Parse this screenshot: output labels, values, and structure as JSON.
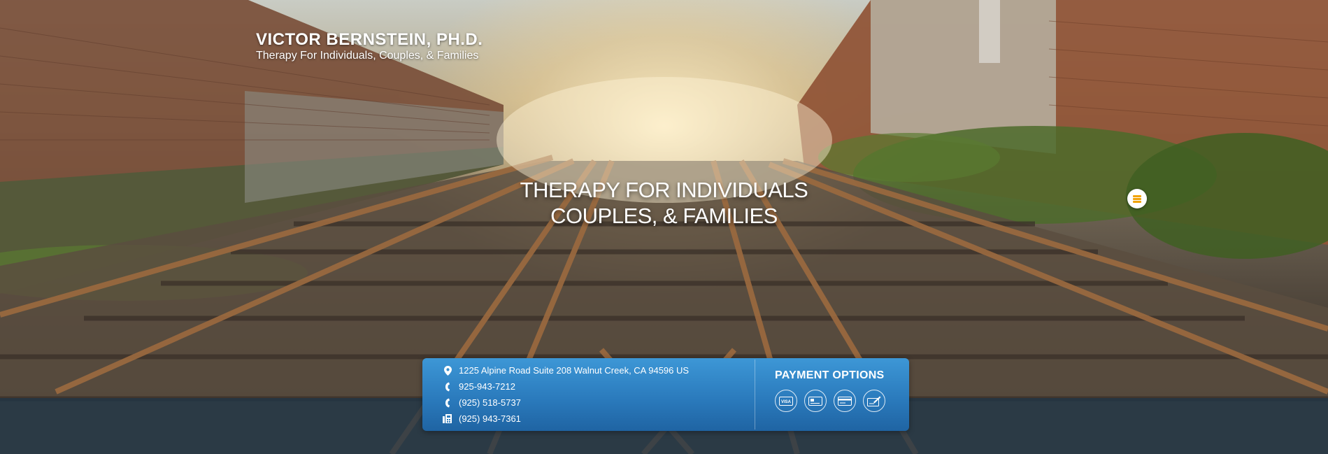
{
  "site": {
    "name": "VICTOR BERNSTEIN, PH.D.",
    "tagline": "Therapy For Individuals, Couples, & Families"
  },
  "hero": {
    "headline_line1": "THERAPY FOR INDIVIDUALS",
    "headline_line2": "COUPLES, & FAMILIES"
  },
  "menu": {
    "icon": "hamburger-menu-icon",
    "accent": "#f0a30a"
  },
  "contact": {
    "address": "1225 Alpine Road Suite 208 Walnut Creek, CA 94596 US",
    "phone1": "925-943-7212",
    "phone2": "(925) 518-5737",
    "fax": "(925) 943-7361",
    "icons": [
      "map-pin-icon",
      "phone-icon",
      "phone-icon",
      "fax-icon"
    ]
  },
  "payment": {
    "title": "PAYMENT OPTIONS",
    "methods": [
      "VISA",
      "card-icon",
      "credit-card-icon",
      "check-icon"
    ]
  },
  "colors": {
    "panel_top": "#3d97d6",
    "panel_bottom": "#1f64a3",
    "footer_band": "#1c344a"
  }
}
